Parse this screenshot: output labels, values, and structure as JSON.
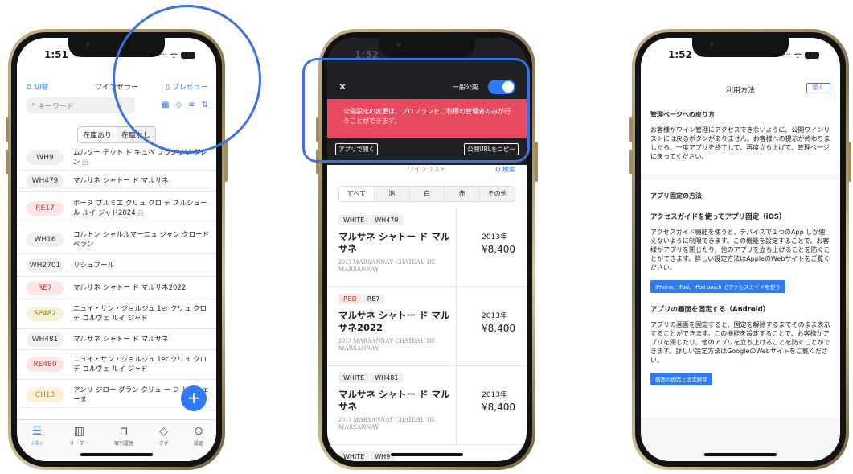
{
  "phone1": {
    "status_time": "1:51",
    "nav": {
      "switch_label": "切替",
      "title": "ワインセラー",
      "preview_label": "プレビュー"
    },
    "search_placeholder": "キーワード",
    "segment": [
      "在庫あり",
      "在庫なし"
    ],
    "rows": [
      {
        "code": "WH9",
        "color": "#efeff0",
        "text": "#333333",
        "name": "ムルソー テット ド キュベ フランソワ ダレン",
        "mark": "回"
      },
      {
        "code": "WH479",
        "color": "#efeff0",
        "text": "#333333",
        "name": "マルサネ シャトー ド マルサネ",
        "mark": ""
      },
      {
        "code": "RE17",
        "color": "#fde4e6",
        "text": "#c0392b",
        "name": "ボーヌ プルミエ クリュ クロ デ ズルシュール ルイ ジャド2024",
        "mark": "回"
      },
      {
        "code": "WH16",
        "color": "#efeff0",
        "text": "#333333",
        "name": "コルトン シャルルマーニュ ジャン クロード ベラン",
        "mark": ""
      },
      {
        "code": "WH2701",
        "color": "#efeff0",
        "text": "#333333",
        "name": "リシュブール",
        "mark": ""
      },
      {
        "code": "RE7",
        "color": "#fde4e6",
        "text": "#c0392b",
        "name": "マルサネ シャトー ド マルサネ2022",
        "mark": ""
      },
      {
        "code": "SP482",
        "color": "#f6f3d8",
        "text": "#8a7a1e",
        "name": "ニュイ・サン・ジョルジュ 1er クリュ クロ デ コルヴェ ルイ ジャド",
        "mark": ""
      },
      {
        "code": "WH481",
        "color": "#efeff0",
        "text": "#333333",
        "name": "マルサネ シャトー ド マルサネ",
        "mark": ""
      },
      {
        "code": "RE480",
        "color": "#fde4e6",
        "text": "#c0392b",
        "name": "ニュイ・サン・ジョルジュ 1er クリュ クロ デ コルヴェ ルイ ジャド",
        "mark": ""
      },
      {
        "code": "CH13",
        "color": "#fdf1d8",
        "text": "#b07a10",
        "name": "アンリ ジロー グラン クリュ ー フ ド・シェーヌ",
        "mark": ""
      }
    ],
    "tabs": [
      {
        "label": "リスト",
        "icon": "list-icon"
      },
      {
        "label": "リーダー",
        "icon": "barcode-icon"
      },
      {
        "label": "取引履歴",
        "icon": "tray-icon"
      },
      {
        "label": "タグ",
        "icon": "tag-icon"
      },
      {
        "label": "設定",
        "icon": "more-icon"
      }
    ]
  },
  "phone2": {
    "status_time": "1:52",
    "public_label": "一般公開",
    "public_enabled": true,
    "alert": "公開設定の変更は、プロプランをご利用の管理者のみが行うことができます。",
    "open_app_label": "アプリで開く",
    "copy_url_label": "公開URLをコピー",
    "list_title": "ワインリスト",
    "search_label": "Q 検索",
    "filters": [
      "すべて",
      "泡",
      "白",
      "赤",
      "その他"
    ],
    "wines": [
      {
        "type": "WHITE",
        "code": "WH479",
        "red": false,
        "name": "マルサネ シャトー ド マルサネ",
        "en": "2013 MARSANNAY CHATEAU DE MARSANNAY",
        "year": "2013年",
        "price": "¥8,400"
      },
      {
        "type": "RED",
        "code": "RE7",
        "red": true,
        "name": "マルサネ シャトー ド マルサネ2022",
        "en": "2013 MARSANNAY CHATEAU DE MARSANNAY",
        "year": "2013年",
        "price": "¥8,400"
      },
      {
        "type": "WHITE",
        "code": "WH481",
        "red": false,
        "name": "マルサネ シャトー ド マルサネ",
        "en": "2013 MARSANNAY CHATEAU DE MARSANNAY",
        "year": "2013年",
        "price": "¥8,400"
      },
      {
        "type": "WHITE",
        "code": "WH9",
        "red": false,
        "name": "",
        "en": "",
        "year": "",
        "price": ""
      }
    ]
  },
  "phone3": {
    "status_time": "1:52",
    "title": "利用方法",
    "close_label": "閉く",
    "sections": [
      {
        "heading": "管理ページへの戻り方",
        "blocks": [
          {
            "text": "お客様がワイン管理にアクセスできないように、公開ワインリストには戻るボタンがありません。お客様への提示が終わりましたら、一度アプリを終了して、再度立ち上げて、管理ページに戻ってください。"
          }
        ]
      },
      {
        "heading": "アプリ固定の方法",
        "blocks": [
          {
            "subheading": "アクセスガイドを使ってアプリ固定（iOS）",
            "text": "アクセスガイド機能を使うと、デバイスで１つのApp しか使えないように制限できます。この機能を設定することで、お客様がアプリを閉じたり、他のアプリを立ち上げることを防ぐことができます。詳しい設定方法はAppleのWebサイトをご覧ください。",
            "link": "iPhone、iPad、iPod touch でアクセスガイドを使う"
          },
          {
            "subheading": "アプリの画面を固定する（Android）",
            "text": "アプリの画面を固定すると、固定を解除するまでそのまま表示することができます。この機能を設定することで、お客様がアプリを閉じたり、他のアプリを立ち上げることを防ぐことができます。詳しい設定方法はGoogleのWebサイトをご覧ください。",
            "link": "画面の固定と固定解除"
          }
        ]
      }
    ]
  },
  "colors": {
    "accent": "#2f7bf5",
    "alert": "#e84a5f",
    "dark_header": "#202124",
    "highlight": "#3f70e0"
  }
}
